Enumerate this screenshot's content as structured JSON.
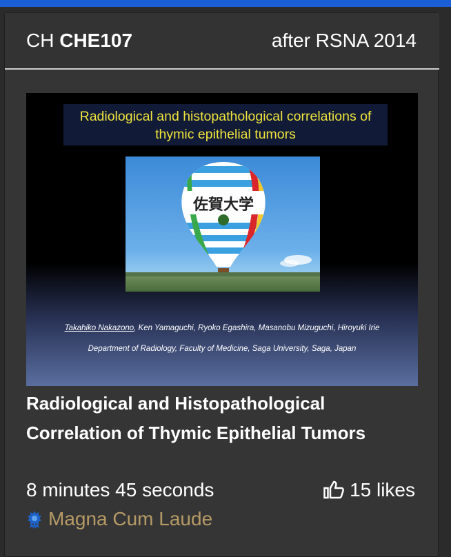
{
  "header": {
    "prefix": "CH",
    "code": "CHE107",
    "conference": "after RSNA 2014"
  },
  "thumbnail": {
    "slide_title": "Radiological and histopathological correlations of thymic epithelial tumors",
    "first_author": "Takahiko Nakazono",
    "other_authors": ", Ken Yamaguchi, Ryoko Egashira, Masanobu Mizuguchi, Hiroyuki Irie",
    "department": "Department of Radiology, Faculty of Medicine, Saga University, Saga, Japan",
    "balloon_text": "佐賀大学"
  },
  "exhibit": {
    "title": "Radiological and Histopathological Correlation of Thymic Epithelial Tumors",
    "duration": "8 minutes 45 seconds",
    "likes": "15 likes",
    "award": "Magna Cum Laude",
    "like_icon": "thumbs-up-icon",
    "award_icon": "award-medal-icon"
  },
  "colors": {
    "top_bar": "#1b5fd6",
    "award": "#b59a66",
    "slide_title_text": "#f0e43a"
  }
}
